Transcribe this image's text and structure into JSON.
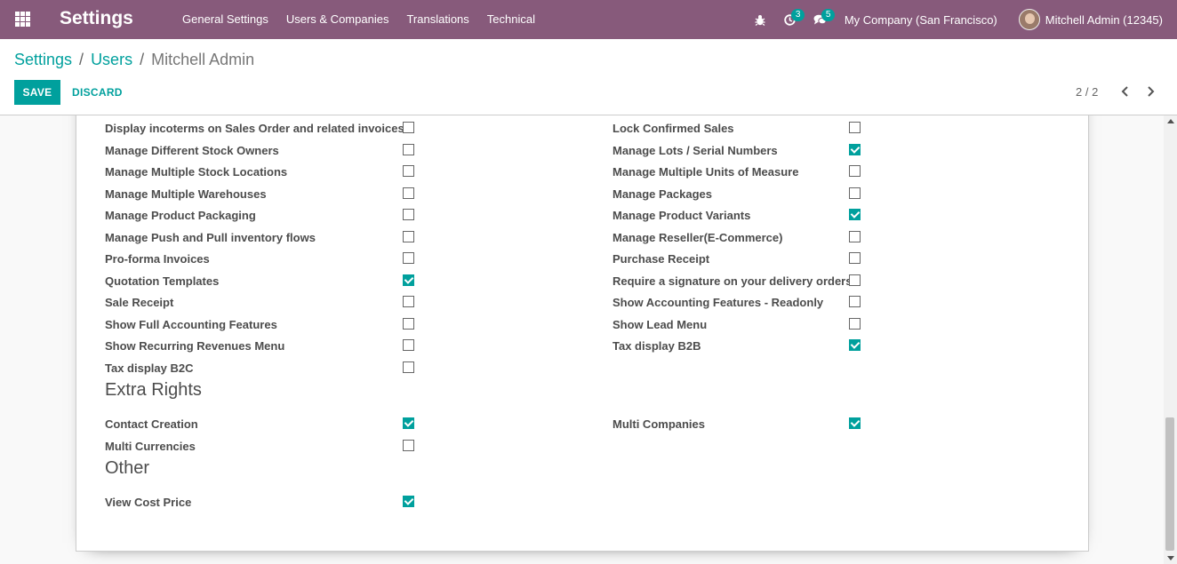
{
  "navbar": {
    "app_title": "Settings",
    "menu": [
      "General Settings",
      "Users & Companies",
      "Translations",
      "Technical"
    ],
    "activity_count": "3",
    "message_count": "5",
    "company": "My Company (San Francisco)",
    "user": "Mitchell Admin (12345)"
  },
  "breadcrumb": {
    "root": "Settings",
    "parent": "Users",
    "current": "Mitchell Admin",
    "separator": "/"
  },
  "buttons": {
    "save": "SAVE",
    "discard": "DISCARD"
  },
  "pager": {
    "value": "2 / 2"
  },
  "colors": {
    "navbar": "#875a7b",
    "accent": "#00a09d"
  },
  "technical_settings": {
    "left": [
      {
        "label": "Display incoterms on Sales Order and related invoices",
        "checked": false
      },
      {
        "label": "Manage Different Stock Owners",
        "checked": false
      },
      {
        "label": "Manage Multiple Stock Locations",
        "checked": false
      },
      {
        "label": "Manage Multiple Warehouses",
        "checked": false
      },
      {
        "label": "Manage Product Packaging",
        "checked": false
      },
      {
        "label": "Manage Push and Pull inventory flows",
        "checked": false
      },
      {
        "label": "Pro-forma Invoices",
        "checked": false
      },
      {
        "label": "Quotation Templates",
        "checked": true
      },
      {
        "label": "Sale Receipt",
        "checked": false
      },
      {
        "label": "Show Full Accounting Features",
        "checked": false
      },
      {
        "label": "Show Recurring Revenues Menu",
        "checked": false
      },
      {
        "label": "Tax display B2C",
        "checked": false
      }
    ],
    "right": [
      {
        "label": "Lock Confirmed Sales",
        "checked": false
      },
      {
        "label": "Manage Lots / Serial Numbers",
        "checked": true
      },
      {
        "label": "Manage Multiple Units of Measure",
        "checked": false
      },
      {
        "label": "Manage Packages",
        "checked": false
      },
      {
        "label": "Manage Product Variants",
        "checked": true
      },
      {
        "label": "Manage Reseller(E-Commerce)",
        "checked": false
      },
      {
        "label": "Purchase Receipt",
        "checked": false
      },
      {
        "label": "Require a signature on your delivery orders",
        "checked": false
      },
      {
        "label": "Show Accounting Features - Readonly",
        "checked": false
      },
      {
        "label": "Show Lead Menu",
        "checked": false
      },
      {
        "label": "Tax display B2B",
        "checked": true
      }
    ]
  },
  "extra_rights": {
    "title": "Extra Rights",
    "left": [
      {
        "label": "Contact Creation",
        "checked": true
      },
      {
        "label": "Multi Currencies",
        "checked": false
      }
    ],
    "right": [
      {
        "label": "Multi Companies",
        "checked": true
      }
    ]
  },
  "other": {
    "title": "Other",
    "left": [
      {
        "label": "View Cost Price",
        "checked": true
      }
    ]
  }
}
